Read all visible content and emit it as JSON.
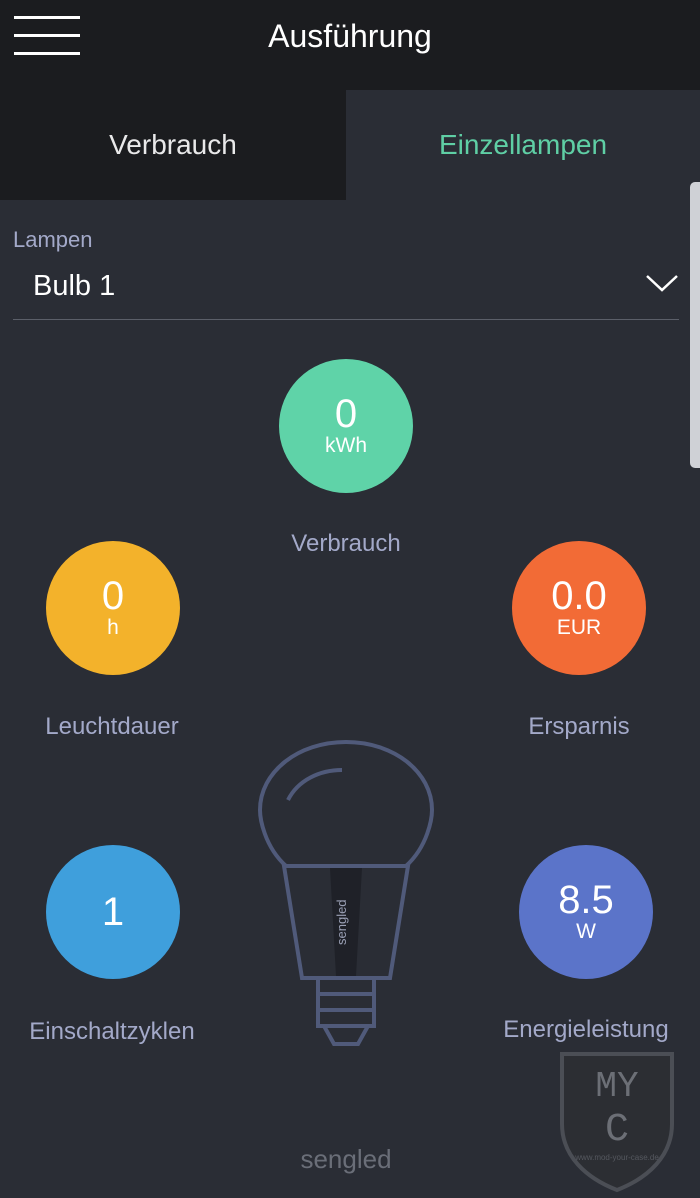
{
  "header": {
    "title": "Ausführung"
  },
  "tabs": [
    {
      "label": "Verbrauch",
      "active": false
    },
    {
      "label": "Einzellampen",
      "active": true
    }
  ],
  "lamp_selector": {
    "label": "Lampen",
    "value": "Bulb 1"
  },
  "stats": {
    "consumption": {
      "value": "0",
      "unit": "kWh",
      "label": "Verbrauch",
      "color": "#5fd3a8"
    },
    "duration": {
      "value": "0",
      "unit": "h",
      "label": "Leuchtdauer",
      "color": "#f3b22b"
    },
    "savings": {
      "value": "0.0",
      "unit": "EUR",
      "label": "Ersparnis",
      "color": "#f26b36"
    },
    "cycles": {
      "value": "1",
      "unit": "",
      "label": "Einschaltzyklen",
      "color": "#3f9fdc"
    },
    "power": {
      "value": "8.5",
      "unit": "W",
      "label": "Energieleistung",
      "color": "#5b74c9"
    }
  },
  "bulb_brand": "sengled",
  "footer_brand": "sengled",
  "watermark": {
    "logo": "MYC",
    "url": "www.mod-your-case.de"
  },
  "colors": {
    "accent": "#5fcfa5",
    "header_bg": "#1b1c1f",
    "body_bg": "#2a2d35",
    "label_text": "#a3a9c9",
    "outline": "#505a7a"
  }
}
